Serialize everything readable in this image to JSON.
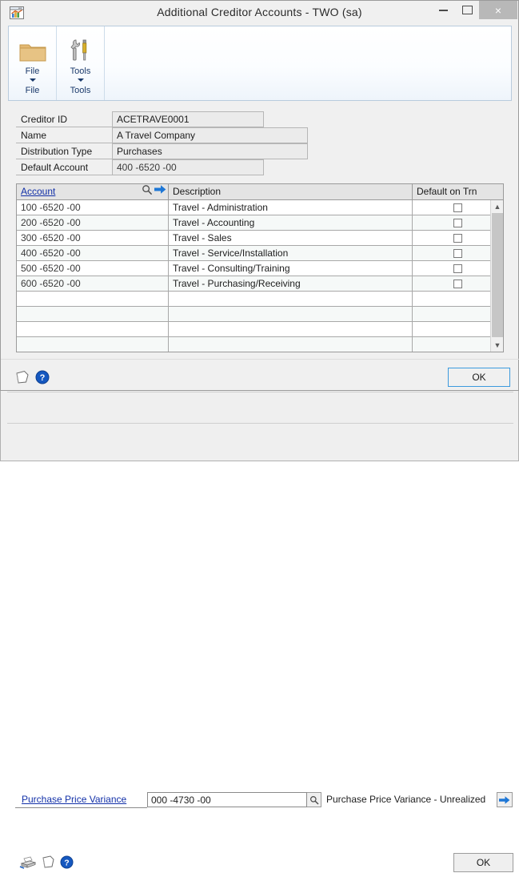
{
  "window": {
    "title": "Additional Creditor Accounts  -  TWO (sa)",
    "app_icon": "window-chart-icon",
    "controls": {
      "minimize": "minimize-icon",
      "maximize": "maximize-icon",
      "close": "×"
    }
  },
  "ribbon": {
    "groups": [
      {
        "label": "File",
        "icon": "folder-icon",
        "group_name": "File"
      },
      {
        "label": "Tools",
        "icon": "tools-icon",
        "group_name": "Tools"
      }
    ]
  },
  "fields": [
    {
      "label": "Creditor ID",
      "value": "ACETRAVE0001"
    },
    {
      "label": "Name",
      "value": "A Travel Company"
    },
    {
      "label": "Distribution Type",
      "value": "Purchases"
    },
    {
      "label": "Default Account",
      "value": "400 -6520 -00"
    }
  ],
  "grid": {
    "columns": [
      {
        "label": "Account",
        "is_link": true
      },
      {
        "label": "Description",
        "is_link": false
      },
      {
        "label": "Default on Trn",
        "is_link": false
      }
    ],
    "header_icons": [
      "magnifier-icon",
      "blue-arrow-right-icon"
    ],
    "rows": [
      {
        "account": "100 -6520 -00",
        "description": "Travel - Administration",
        "default_on_trn": false
      },
      {
        "account": "200 -6520 -00",
        "description": "Travel - Accounting",
        "default_on_trn": false
      },
      {
        "account": "300 -6520 -00",
        "description": "Travel - Sales",
        "default_on_trn": false
      },
      {
        "account": "400 -6520 -00",
        "description": "Travel - Service/Installation",
        "default_on_trn": false
      },
      {
        "account": "500 -6520 -00",
        "description": "Travel - Consulting/Training",
        "default_on_trn": false
      },
      {
        "account": "600 -6520 -00",
        "description": "Travel - Purchasing/Receiving",
        "default_on_trn": false
      },
      {
        "account": "",
        "description": "",
        "default_on_trn": null
      },
      {
        "account": "",
        "description": "",
        "default_on_trn": null
      },
      {
        "account": "",
        "description": "",
        "default_on_trn": null
      },
      {
        "account": "",
        "description": "",
        "default_on_trn": null
      }
    ]
  },
  "dialog_footer": {
    "icons": [
      "note-icon",
      "help-icon"
    ],
    "ok_label": "OK"
  },
  "background_window": {
    "row": {
      "link_label": "Purchase Price Variance",
      "account_value": "000 -4730 -00",
      "magnifier": "magnifier-icon",
      "description": "Purchase Price Variance - Unrealized",
      "arrow": "blue-arrow-right-icon"
    },
    "footer": {
      "icons": [
        "printer-icon",
        "note-icon",
        "help-icon"
      ],
      "ok_label": "OK"
    }
  },
  "colors": {
    "accent_link": "#1230a8",
    "focus_border": "#3c9ade",
    "window_bg": "#f0f0f0",
    "grid_alt_row": "#f6f9f8"
  }
}
